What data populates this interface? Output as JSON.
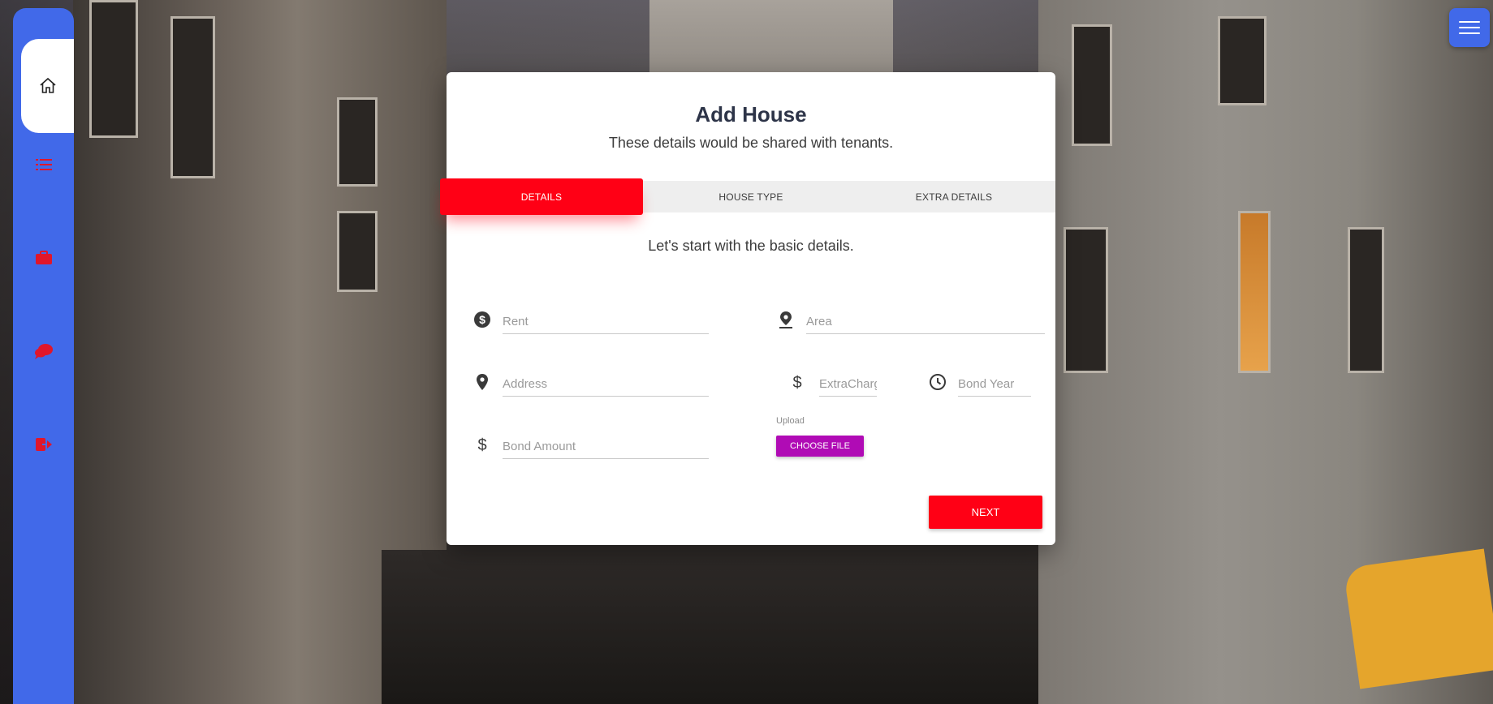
{
  "sidebar": {
    "items": [
      {
        "icon": "home-icon"
      },
      {
        "icon": "list-icon"
      },
      {
        "icon": "briefcase-icon"
      },
      {
        "icon": "chat-icon"
      },
      {
        "icon": "logout-icon"
      }
    ]
  },
  "menu": {
    "icon": "hamburger-icon"
  },
  "card": {
    "title": "Add House",
    "subtitle": "These details would be shared with tenants.",
    "tabs": [
      "DETAILS",
      "HOUSE TYPE",
      "EXTRA DETAILS"
    ],
    "active_tab": "DETAILS",
    "lead": "Let's start with the basic details.",
    "fields": {
      "rent": {
        "placeholder": "Rent",
        "value": "",
        "icon": "dollar-circle-icon"
      },
      "area": {
        "placeholder": "Area",
        "value": "",
        "icon": "location-pin-icon"
      },
      "address": {
        "placeholder": "Address",
        "value": "",
        "icon": "map-marker-icon"
      },
      "extra_charges": {
        "placeholder": "ExtraCharges",
        "value": "",
        "icon": "dollar-icon"
      },
      "bond_year": {
        "placeholder": "Bond Year",
        "value": "",
        "icon": "clock-icon"
      },
      "bond_amount": {
        "placeholder": "Bond Amount",
        "value": "",
        "icon": "dollar-icon"
      }
    },
    "upload_label": "Upload",
    "choose_file": "CHOOSE FILE",
    "next": "NEXT"
  },
  "colors": {
    "sidebar": "#4169e9",
    "accent_red": "#ff0015",
    "upload_purple": "#b00bb5",
    "sidebar_icon_red": "#e0162b"
  }
}
